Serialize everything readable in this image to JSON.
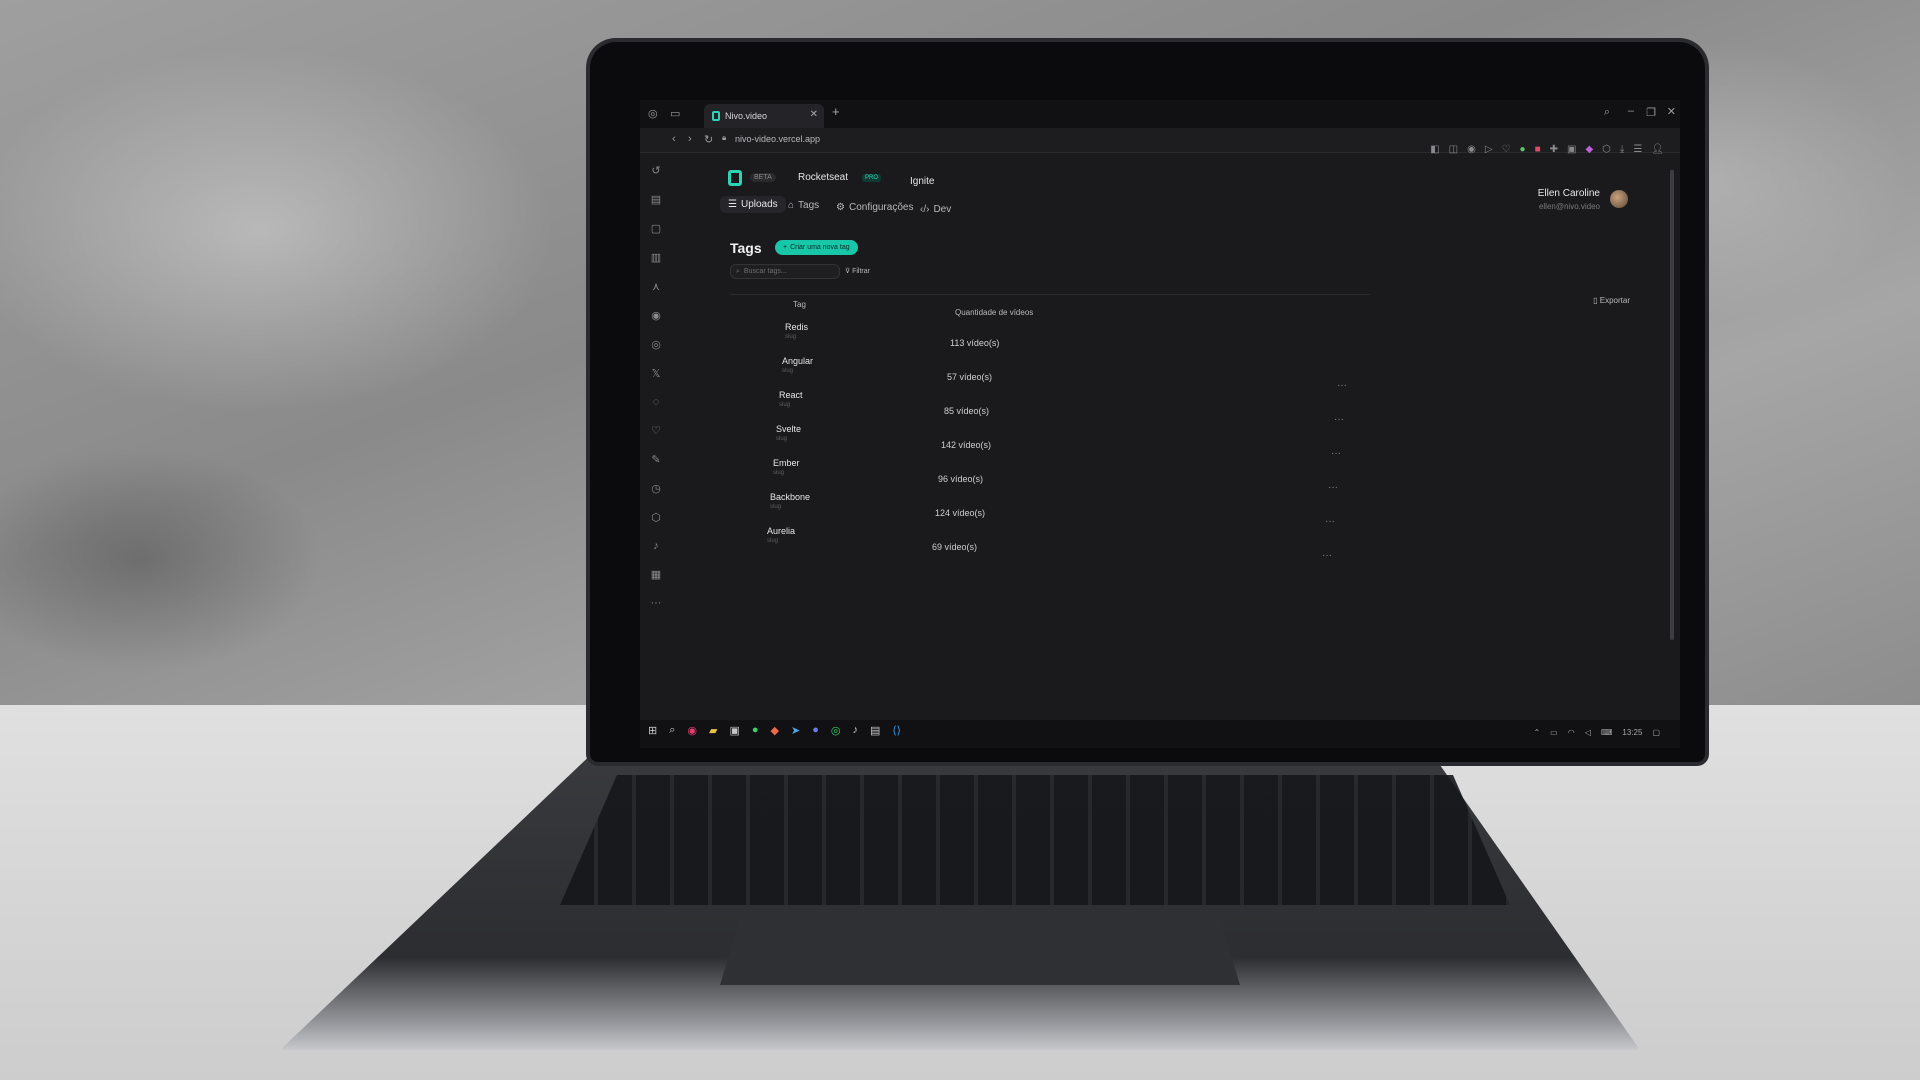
{
  "browser": {
    "tab_title": "Nivo.video",
    "url": "nivo-video.vercel.app"
  },
  "header": {
    "beta_badge": "BETA",
    "org_name": "Rocketseat",
    "plan_badge": "PRO",
    "project_name": "Ignite",
    "nav": [
      {
        "label": "Uploads",
        "active": true
      },
      {
        "label": "Tags",
        "active": false
      },
      {
        "label": "Configurações",
        "active": false
      },
      {
        "label": "Dev",
        "active": false
      }
    ],
    "user_name": "Ellen Caroline",
    "user_email": "ellen@nivo.video"
  },
  "main": {
    "title": "Tags",
    "create_button": "Criar uma nova tag",
    "search_placeholder": "Buscar tags...",
    "filter_label": "Filtrar",
    "export_label": "Exportar",
    "columns": {
      "tag": "Tag",
      "quantity": "Quantidade de vídeos"
    },
    "rows": [
      {
        "name": "Redis",
        "slug": "slug",
        "count": "113 vídeo(s)"
      },
      {
        "name": "Angular",
        "slug": "slug",
        "count": "57 vídeo(s)"
      },
      {
        "name": "React",
        "slug": "slug",
        "count": "85 vídeo(s)"
      },
      {
        "name": "Svelte",
        "slug": "slug",
        "count": "142 vídeo(s)"
      },
      {
        "name": "Ember",
        "slug": "slug",
        "count": "96 vídeo(s)"
      },
      {
        "name": "Backbone",
        "slug": "slug",
        "count": "124 vídeo(s)"
      },
      {
        "name": "Aurelia",
        "slug": "slug",
        "count": "69 vídeo(s)"
      }
    ]
  },
  "taskbar": {
    "time": "13:25"
  },
  "colors": {
    "accent": "#18c7a8",
    "background": "#1a1a1c"
  }
}
